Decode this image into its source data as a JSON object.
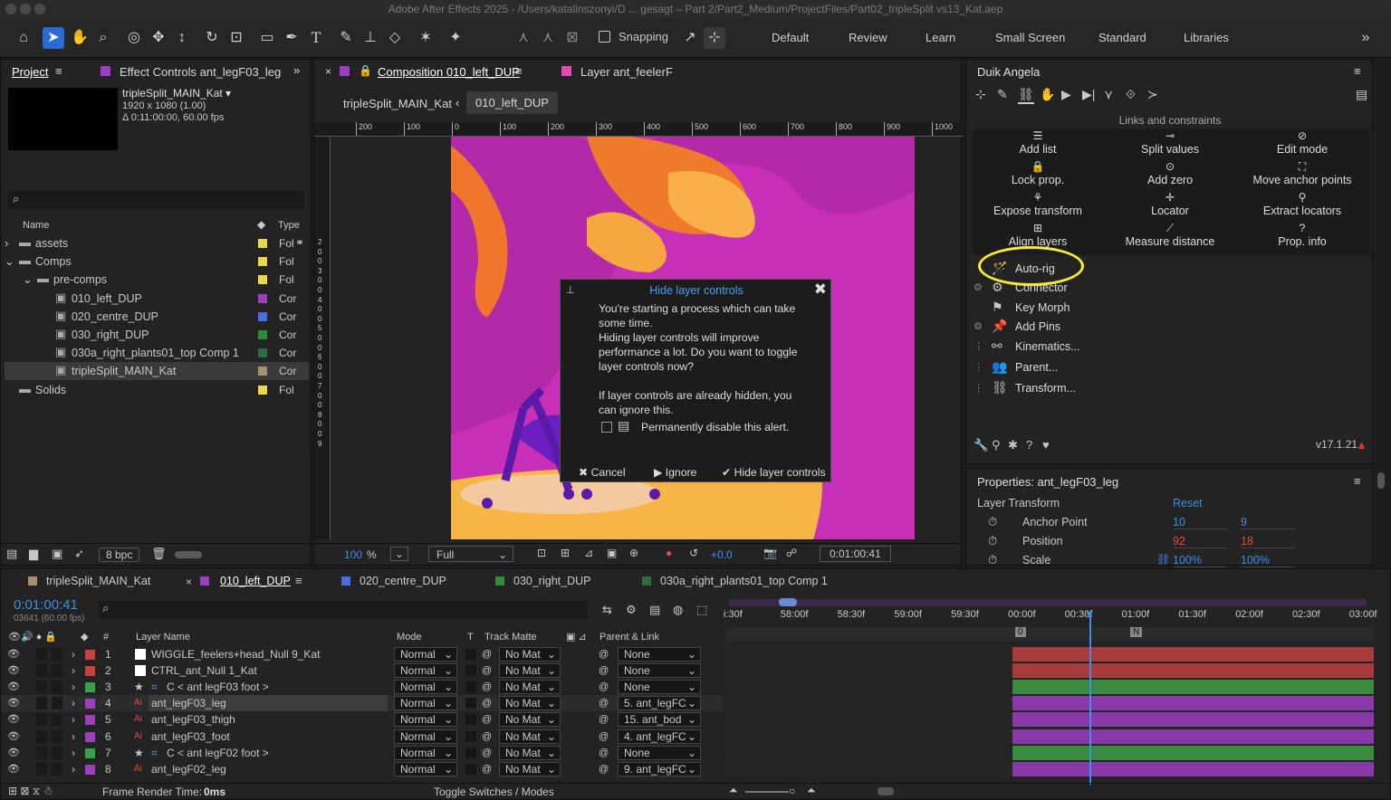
{
  "window_title": "Adobe After Effects 2025 - /Users/katalinszonyi/D ... gesagt – Part 2/Part2_Medium/ProjectFiles/Part02_tripleSplit vs13_Kat.aep",
  "toolbar": {
    "snapping": "Snapping",
    "workspaces": [
      "Default",
      "Review",
      "Learn",
      "Small Screen",
      "Standard",
      "Libraries"
    ]
  },
  "project": {
    "tab_project": "Project",
    "tab_effect": "Effect Controls ant_legF03_leg",
    "comp_name": "tripleSplit_MAIN_Kat ▾",
    "comp_res": "1920 x 1080 (1.00)",
    "comp_dur": "Δ 0:11:00:00, 60.00 fps",
    "col_name": "Name",
    "col_type": "Type",
    "bpc": "8 bpc",
    "items": [
      {
        "name": "assets",
        "type": "Fol",
        "color": "#e8d84a"
      },
      {
        "name": "Comps",
        "type": "Fol",
        "color": "#e8d84a"
      },
      {
        "name": "pre-comps",
        "type": "Fol",
        "color": "#e8d84a"
      },
      {
        "name": "010_left_DUP",
        "type": "Cor",
        "color": "#9b3fbf"
      },
      {
        "name": "020_centre_DUP",
        "type": "Cor",
        "color": "#4a6fe0"
      },
      {
        "name": "030_right_DUP",
        "type": "Cor",
        "color": "#2e8b3e"
      },
      {
        "name": "030a_right_plants01_top Comp 1",
        "type": "Cor",
        "color": "#2e6b3e"
      },
      {
        "name": "tripleSplit_MAIN_Kat",
        "type": "Cor",
        "color": "#a88e74"
      },
      {
        "name": "Solids",
        "type": "Fol",
        "color": "#e8d84a"
      }
    ]
  },
  "comp": {
    "tab_comp": "Composition 010_left_DUP",
    "tab_layer": "Layer ant_feelerF",
    "crumb1": "tripleSplit_MAIN_Kat",
    "crumb2": "010_left_DUP",
    "zoom": "100",
    "zoom_unit": "%",
    "quality": "Full",
    "exposure": "+0.0",
    "time": "0:01:00:41",
    "ruler_top": [
      "200",
      "100",
      "0",
      "100",
      "200",
      "300",
      "400",
      "500",
      "600",
      "700",
      "800",
      "900",
      "1000"
    ],
    "ruler_left": [
      "2",
      "0",
      "0",
      "3",
      "0",
      "0",
      "4",
      "0",
      "0",
      "5",
      "0",
      "0",
      "6",
      "0",
      "0",
      "7",
      "0",
      "0",
      "8",
      "0",
      "0",
      "9"
    ]
  },
  "dialog": {
    "title": "Hide layer controls",
    "body1": "You're starting a process which can take some time.",
    "body2": "Hiding layer controls will improve performance a lot. Do you want to toggle layer controls now?",
    "body3": "If layer controls are already hidden, you can ignore this.",
    "checkbox": "Permanently disable this alert.",
    "cancel": "Cancel",
    "ignore": "Ignore",
    "confirm": "Hide layer controls"
  },
  "duik": {
    "title": "Duik Angela",
    "section": "Links and constraints",
    "grid": [
      "Add list",
      "Split values",
      "Edit mode",
      "Lock prop.",
      "Add zero",
      "Move anchor points",
      "Expose transform",
      "Locator",
      "Extract locators",
      "Align layers",
      "Measure distance",
      "Prop. info"
    ],
    "tools": [
      "Auto-rig",
      "Connector",
      "Key Morph",
      "Add Pins",
      "Kinematics...",
      "Parent...",
      "Transform..."
    ],
    "version": "v17.1.21"
  },
  "properties": {
    "title": "Properties: ant_legF03_leg",
    "section": "Layer Transform",
    "reset": "Reset",
    "rows": [
      {
        "label": "Anchor Point",
        "v1": "10",
        "v2": "9",
        "c1": "#3d8ee8",
        "c2": "#3d8ee8"
      },
      {
        "label": "Position",
        "v1": "92",
        "v2": "18",
        "c1": "#e84a3d",
        "c2": "#e84a3d"
      },
      {
        "label": "Scale",
        "v1": "100%",
        "v2": "100%",
        "c1": "#3d8ee8",
        "c2": "#3d8ee8"
      }
    ]
  },
  "timeline": {
    "tabs": [
      {
        "name": "tripleSplit_MAIN_Kat",
        "color": "#a88e74"
      },
      {
        "name": "010_left_DUP",
        "color": "#9b3fbf"
      },
      {
        "name": "020_centre_DUP",
        "color": "#4a6fe0"
      },
      {
        "name": "030_right_DUP",
        "color": "#2e8b3e"
      },
      {
        "name": "030a_right_plants01_top Comp 1",
        "color": "#2e6b3e"
      }
    ],
    "timecode": "0:01:00:41",
    "frames": "03641 (60.00 fps)",
    "col_layer": "Layer Name",
    "col_mode": "Mode",
    "col_t": "T",
    "col_track": "Track Matte",
    "col_parent": "Parent & Link",
    "ruler": [
      "i:30f",
      "58:00f",
      "58:30f",
      "59:00f",
      "59:30f",
      "00:00f",
      "00:30f",
      "01:00f",
      "01:30f",
      "02:00f",
      "02:30f",
      "03:00f"
    ],
    "layers": [
      {
        "num": "1",
        "name": "WIGGLE_feelers+head_Null 9_Kat",
        "color": "#c94040",
        "mode": "Normal",
        "matte": "No Mat",
        "parent": "None",
        "bar": "#a83a3a"
      },
      {
        "num": "2",
        "name": "CTRL_ant_Null 1_Kat",
        "color": "#c94040",
        "mode": "Normal",
        "matte": "No Mat",
        "parent": "None",
        "bar": "#a83a3a"
      },
      {
        "num": "3",
        "name": "C < ant legF03 foot >",
        "color": "#3aa04a",
        "mode": "Normal",
        "matte": "No Mat",
        "parent": "None",
        "bar": "#3a8a40"
      },
      {
        "num": "4",
        "name": "ant_legF03_leg",
        "color": "#9b3fbf",
        "mode": "Normal",
        "matte": "No Mat",
        "parent": "5. ant_legFC",
        "bar": "#8a3aa8"
      },
      {
        "num": "5",
        "name": "ant_legF03_thigh",
        "color": "#9b3fbf",
        "mode": "Normal",
        "matte": "No Mat",
        "parent": "15. ant_bod",
        "bar": "#8a3aa8"
      },
      {
        "num": "6",
        "name": "ant_legF03_foot",
        "color": "#9b3fbf",
        "mode": "Normal",
        "matte": "No Mat",
        "parent": "4. ant_legFC",
        "bar": "#8a3aa8"
      },
      {
        "num": "7",
        "name": "C < ant legF02 foot >",
        "color": "#3aa04a",
        "mode": "Normal",
        "matte": "No Mat",
        "parent": "None",
        "bar": "#3a8a40"
      },
      {
        "num": "8",
        "name": "ant_legF02_leg",
        "color": "#9b3fbf",
        "mode": "Normal",
        "matte": "No Mat",
        "parent": "9. ant_legFC",
        "bar": "#8a3aa8"
      }
    ],
    "render_label": "Frame Render Time:",
    "render_val": "0ms",
    "toggle": "Toggle Switches / Modes"
  }
}
